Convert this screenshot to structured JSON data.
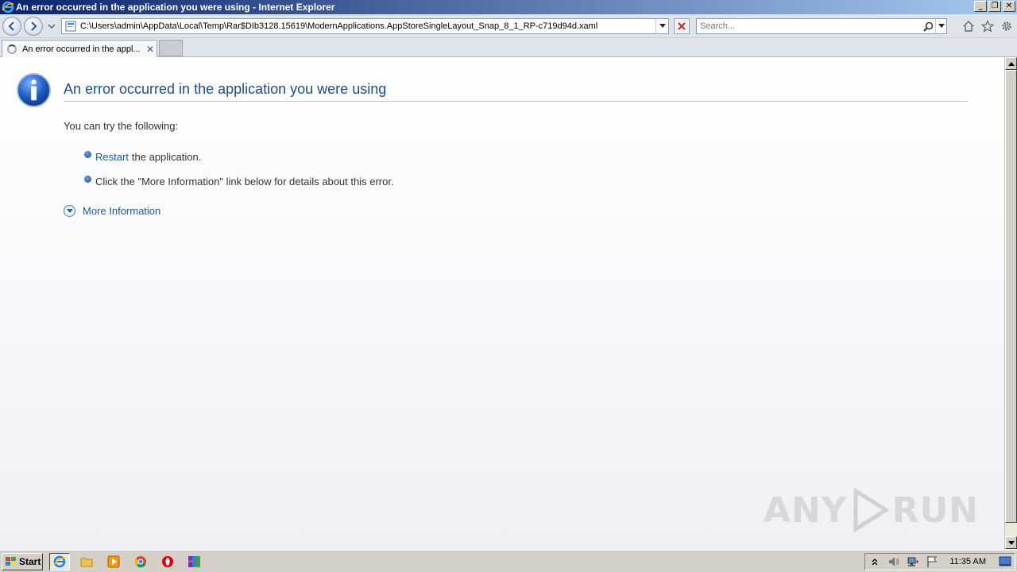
{
  "window": {
    "title": "An error occurred in the application you were using - Internet Explorer",
    "minimize_label": "_",
    "maximize_label": "❐",
    "close_label": "✕"
  },
  "address_bar": {
    "url": "C:\\Users\\admin\\AppData\\Local\\Temp\\Rar$DIb3128.15619\\ModernApplications.AppStoreSingleLayout_Snap_8_1_RP-c719d94d.xaml"
  },
  "search": {
    "placeholder": "Search..."
  },
  "tabs": [
    {
      "label": "An error occurred in the appl...",
      "close": "✕"
    }
  ],
  "error_page": {
    "heading": "An error occurred in the application you were using",
    "subtext": "You can try the following:",
    "bullets": [
      {
        "link": "Restart",
        "text": "the application."
      },
      {
        "link": "",
        "text": "Click the \"More Information\" link below for details about this error."
      }
    ],
    "more_info": "More Information"
  },
  "watermark": {
    "left": "ANY",
    "right": "RUN"
  },
  "taskbar": {
    "start_label": "Start",
    "clock": "11:35 AM"
  },
  "colors": {
    "heading": "#1f4e8c",
    "link": "#1a5aa0",
    "titlebar_start": "#0a246a",
    "titlebar_end": "#a6caf0"
  }
}
